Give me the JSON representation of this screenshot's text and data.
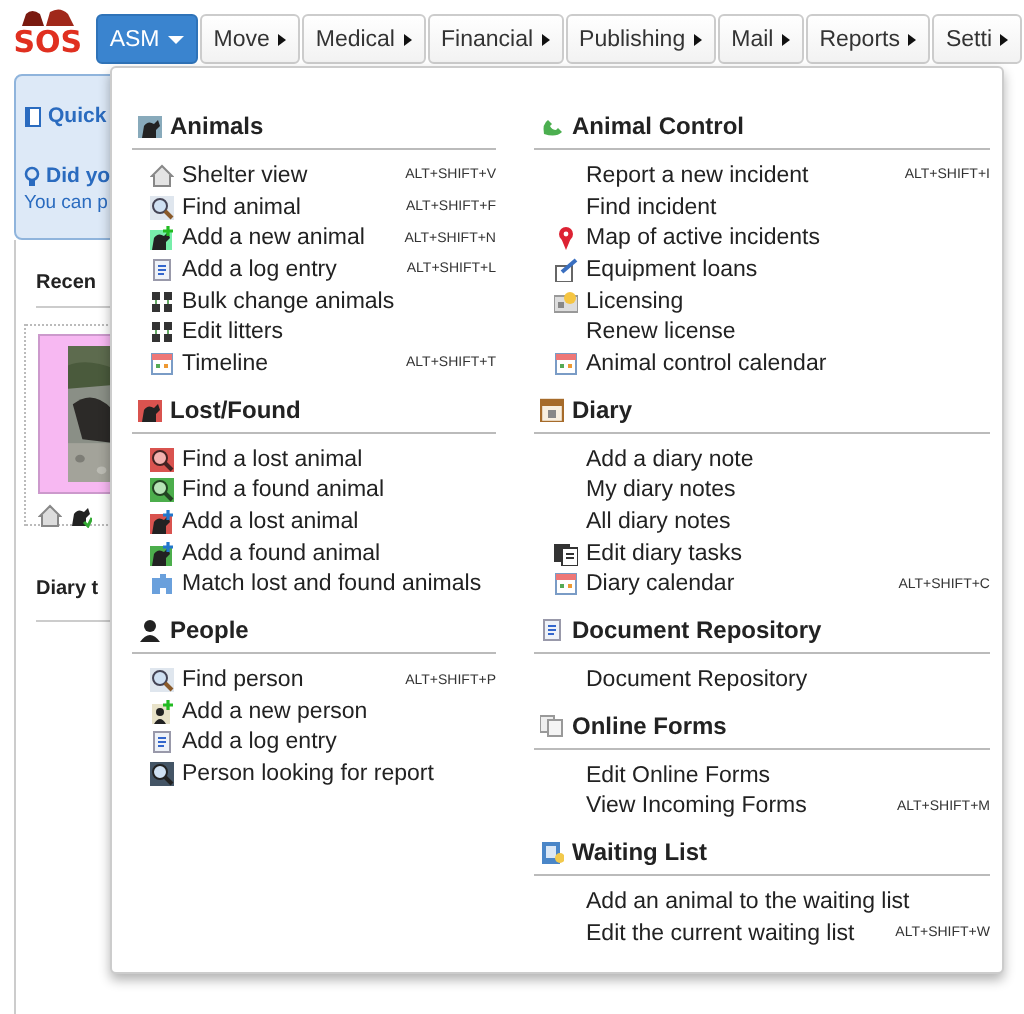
{
  "logo": {
    "text": "SOS"
  },
  "nav": [
    {
      "label": "ASM",
      "selected": true
    },
    {
      "label": "Move",
      "selected": false
    },
    {
      "label": "Medical",
      "selected": false
    },
    {
      "label": "Financial",
      "selected": false
    },
    {
      "label": "Publishing",
      "selected": false
    },
    {
      "label": "Mail",
      "selected": false
    },
    {
      "label": "Reports",
      "selected": false
    },
    {
      "label": "Setti",
      "selected": false
    }
  ],
  "background": {
    "quick_link": "Quick",
    "tip_title": "Did yo",
    "tip_text": "You can p",
    "recent_heading": "Recen",
    "diary_heading": "Diary t"
  },
  "menu": {
    "columns": [
      [
        {
          "title": "Animals",
          "items": [
            {
              "label": "Shelter view",
              "shortcut": "ALT+SHIFT+V",
              "kind": "icon"
            },
            {
              "label": "Find animal",
              "shortcut": "ALT+SHIFT+F",
              "kind": "icon"
            },
            {
              "label": "Add a new animal",
              "shortcut": "ALT+SHIFT+N",
              "kind": "icon"
            },
            {
              "label": "Add a log entry",
              "shortcut": "ALT+SHIFT+L",
              "kind": "icon"
            },
            {
              "label": "Bulk change animals",
              "kind": "icon"
            },
            {
              "label": "Edit litters",
              "kind": "icon"
            },
            {
              "label": "Timeline",
              "shortcut": "ALT+SHIFT+T",
              "kind": "icon"
            }
          ]
        },
        {
          "title": "Lost/Found",
          "items": [
            {
              "label": "Find a lost animal",
              "kind": "icon"
            },
            {
              "label": "Find a found animal",
              "kind": "icon"
            },
            {
              "label": "Add a lost animal",
              "kind": "icon"
            },
            {
              "label": "Add a found animal",
              "kind": "icon"
            },
            {
              "label": "Match lost and found animals",
              "kind": "icon"
            }
          ]
        },
        {
          "title": "People",
          "items": [
            {
              "label": "Find person",
              "shortcut": "ALT+SHIFT+P",
              "kind": "icon"
            },
            {
              "label": "Add a new person",
              "kind": "icon"
            },
            {
              "label": "Add a log entry",
              "kind": "icon"
            },
            {
              "label": "Person looking for report",
              "kind": "icon"
            }
          ]
        }
      ],
      [
        {
          "title": "Animal Control",
          "items": [
            {
              "label": "Report a new incident",
              "shortcut": "ALT+SHIFT+I",
              "kind": "plain"
            },
            {
              "label": "Find incident",
              "kind": "plain"
            },
            {
              "label": "Map of active incidents",
              "kind": "icon"
            },
            {
              "label": "Equipment loans",
              "kind": "icon"
            },
            {
              "label": "Licensing",
              "kind": "icon"
            },
            {
              "label": "Renew license",
              "kind": "plain"
            },
            {
              "label": "Animal control calendar",
              "kind": "icon"
            }
          ]
        },
        {
          "title": "Diary",
          "items": [
            {
              "label": "Add a diary note",
              "kind": "plain"
            },
            {
              "label": "My diary notes",
              "kind": "plain"
            },
            {
              "label": "All diary notes",
              "kind": "plain"
            },
            {
              "label": "Edit diary tasks",
              "kind": "icon"
            },
            {
              "label": "Diary calendar",
              "shortcut": "ALT+SHIFT+C",
              "kind": "icon"
            }
          ]
        },
        {
          "title": "Document Repository",
          "items": [
            {
              "label": "Document Repository",
              "kind": "plain"
            }
          ]
        },
        {
          "title": "Online Forms",
          "items": [
            {
              "label": "Edit Online Forms",
              "kind": "plain"
            },
            {
              "label": "View Incoming Forms",
              "shortcut": "ALT+SHIFT+M",
              "kind": "plain"
            }
          ]
        },
        {
          "title": "Waiting List",
          "items": [
            {
              "label": "Add an animal to the waiting list",
              "kind": "plain"
            },
            {
              "label": "Edit the current waiting list",
              "shortcut": "ALT+SHIFT+W",
              "kind": "plain"
            }
          ]
        }
      ]
    ]
  }
}
